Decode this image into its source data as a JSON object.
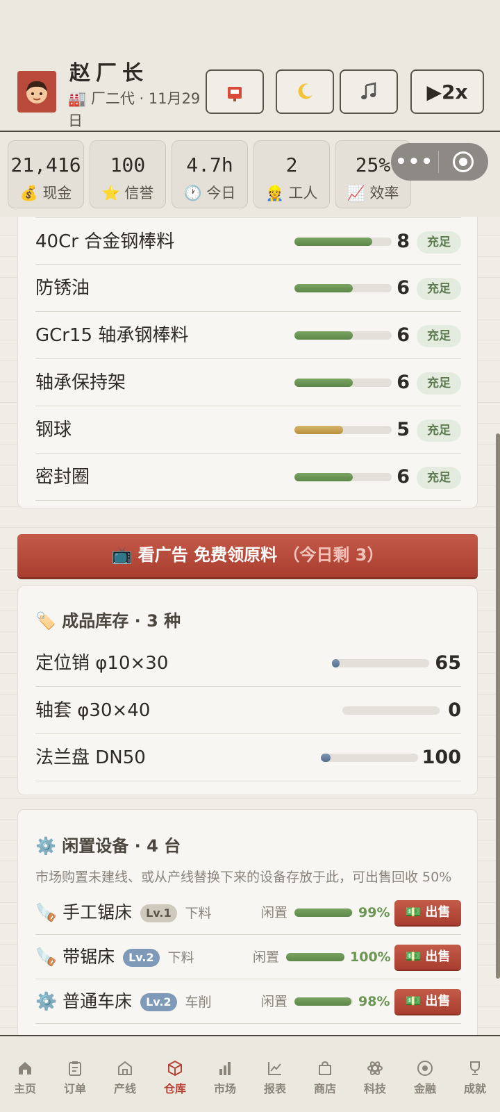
{
  "header": {
    "name": "赵厂长",
    "subtitle": "🏭 厂二代 · 11月29日",
    "speed_label": "▶2x"
  },
  "stats": [
    {
      "value": "21,416",
      "label": "💰 现金"
    },
    {
      "value": "100",
      "label": "⭐ 信誉"
    },
    {
      "value": "4.7h",
      "label": "🕐 今日"
    },
    {
      "value": "2",
      "label": "👷 工人"
    },
    {
      "value": "25%",
      "label": "📈 效率"
    }
  ],
  "materials": [
    {
      "name": "40Cr 合金钢棒料",
      "qty": "8",
      "status": "充足",
      "level": 0.8,
      "color": "green"
    },
    {
      "name": "防锈油",
      "qty": "6",
      "status": "充足",
      "level": 0.6,
      "color": "green"
    },
    {
      "name": "GCr15 轴承钢棒料",
      "qty": "6",
      "status": "充足",
      "level": 0.6,
      "color": "green"
    },
    {
      "name": "轴承保持架",
      "qty": "6",
      "status": "充足",
      "level": 0.6,
      "color": "green"
    },
    {
      "name": "钢球",
      "qty": "5",
      "status": "充足",
      "level": 0.5,
      "color": "gold"
    },
    {
      "name": "密封圈",
      "qty": "6",
      "status": "充足",
      "level": 0.6,
      "color": "green"
    }
  ],
  "ad_button": {
    "label": "📺 看广告 免费领原料",
    "remaining": "（今日剩 3）"
  },
  "products": {
    "title": "🏷️ 成品库存 · 3 种",
    "items": [
      {
        "name": "定位销 φ10×30",
        "qty": "65",
        "level": 0.065
      },
      {
        "name": "轴套 φ30×40",
        "qty": "0",
        "level": 0
      },
      {
        "name": "法兰盘 DN50",
        "qty": "100",
        "level": 0.1
      }
    ]
  },
  "equipment": {
    "title": "⚙️ 闲置设备 · 4 台",
    "desc": "市场购置未建线、或从产线替换下来的设备存放于此，可出售回收 50%",
    "items": [
      {
        "icon": "🪚",
        "name": "手工锯床",
        "lv": "Lv.1",
        "category": "下料",
        "status": "闲置",
        "pct": "99%",
        "level": 0.99,
        "sell": "💵 出售"
      },
      {
        "icon": "🪚",
        "name": "带锯床",
        "lv": "Lv.2",
        "category": "下料",
        "status": "闲置",
        "pct": "100%",
        "level": 1.0,
        "sell": "💵 出售"
      },
      {
        "icon": "⚙️",
        "name": "普通车床",
        "lv": "Lv.2",
        "category": "车削",
        "status": "闲置",
        "pct": "98%",
        "level": 0.98,
        "sell": "💵 出售"
      }
    ]
  },
  "nav": [
    {
      "label": "主页",
      "icon": "home-icon"
    },
    {
      "label": "订单",
      "icon": "clipboard-icon"
    },
    {
      "label": "产线",
      "icon": "factory-icon"
    },
    {
      "label": "仓库",
      "icon": "box-icon",
      "active": true
    },
    {
      "label": "市场",
      "icon": "bar-chart-icon"
    },
    {
      "label": "报表",
      "icon": "line-chart-icon"
    },
    {
      "label": "商店",
      "icon": "shop-icon"
    },
    {
      "label": "科技",
      "icon": "atom-icon"
    },
    {
      "label": "金融",
      "icon": "coin-icon"
    },
    {
      "label": "成就",
      "icon": "trophy-icon"
    }
  ],
  "colors": {
    "accent": "#b54536",
    "good": "#6b9553",
    "bar_green": "#5c8748",
    "bar_gold": "#b8913e",
    "bar_blue": "#55708f"
  }
}
